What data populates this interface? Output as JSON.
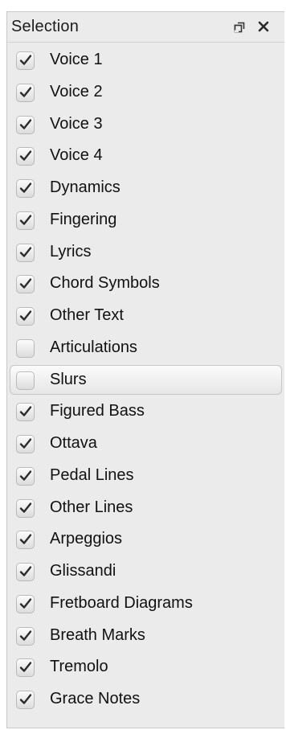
{
  "panel": {
    "title": "Selection",
    "float_icon": "float-panel-icon",
    "close_icon": "close-icon"
  },
  "items": [
    {
      "label": "Voice 1",
      "checked": true
    },
    {
      "label": "Voice 2",
      "checked": true
    },
    {
      "label": "Voice 3",
      "checked": true
    },
    {
      "label": "Voice 4",
      "checked": true
    },
    {
      "label": "Dynamics",
      "checked": true
    },
    {
      "label": "Fingering",
      "checked": true
    },
    {
      "label": "Lyrics",
      "checked": true
    },
    {
      "label": "Chord Symbols",
      "checked": true
    },
    {
      "label": "Other Text",
      "checked": true
    },
    {
      "label": "Articulations",
      "checked": false
    },
    {
      "label": "Slurs",
      "checked": false,
      "highlighted": true
    },
    {
      "label": "Figured Bass",
      "checked": true
    },
    {
      "label": "Ottava",
      "checked": true
    },
    {
      "label": "Pedal Lines",
      "checked": true
    },
    {
      "label": "Other Lines",
      "checked": true
    },
    {
      "label": "Arpeggios",
      "checked": true
    },
    {
      "label": "Glissandi",
      "checked": true
    },
    {
      "label": "Fretboard Diagrams",
      "checked": true
    },
    {
      "label": "Breath Marks",
      "checked": true
    },
    {
      "label": "Tremolo",
      "checked": true
    },
    {
      "label": "Grace Notes",
      "checked": true
    }
  ]
}
